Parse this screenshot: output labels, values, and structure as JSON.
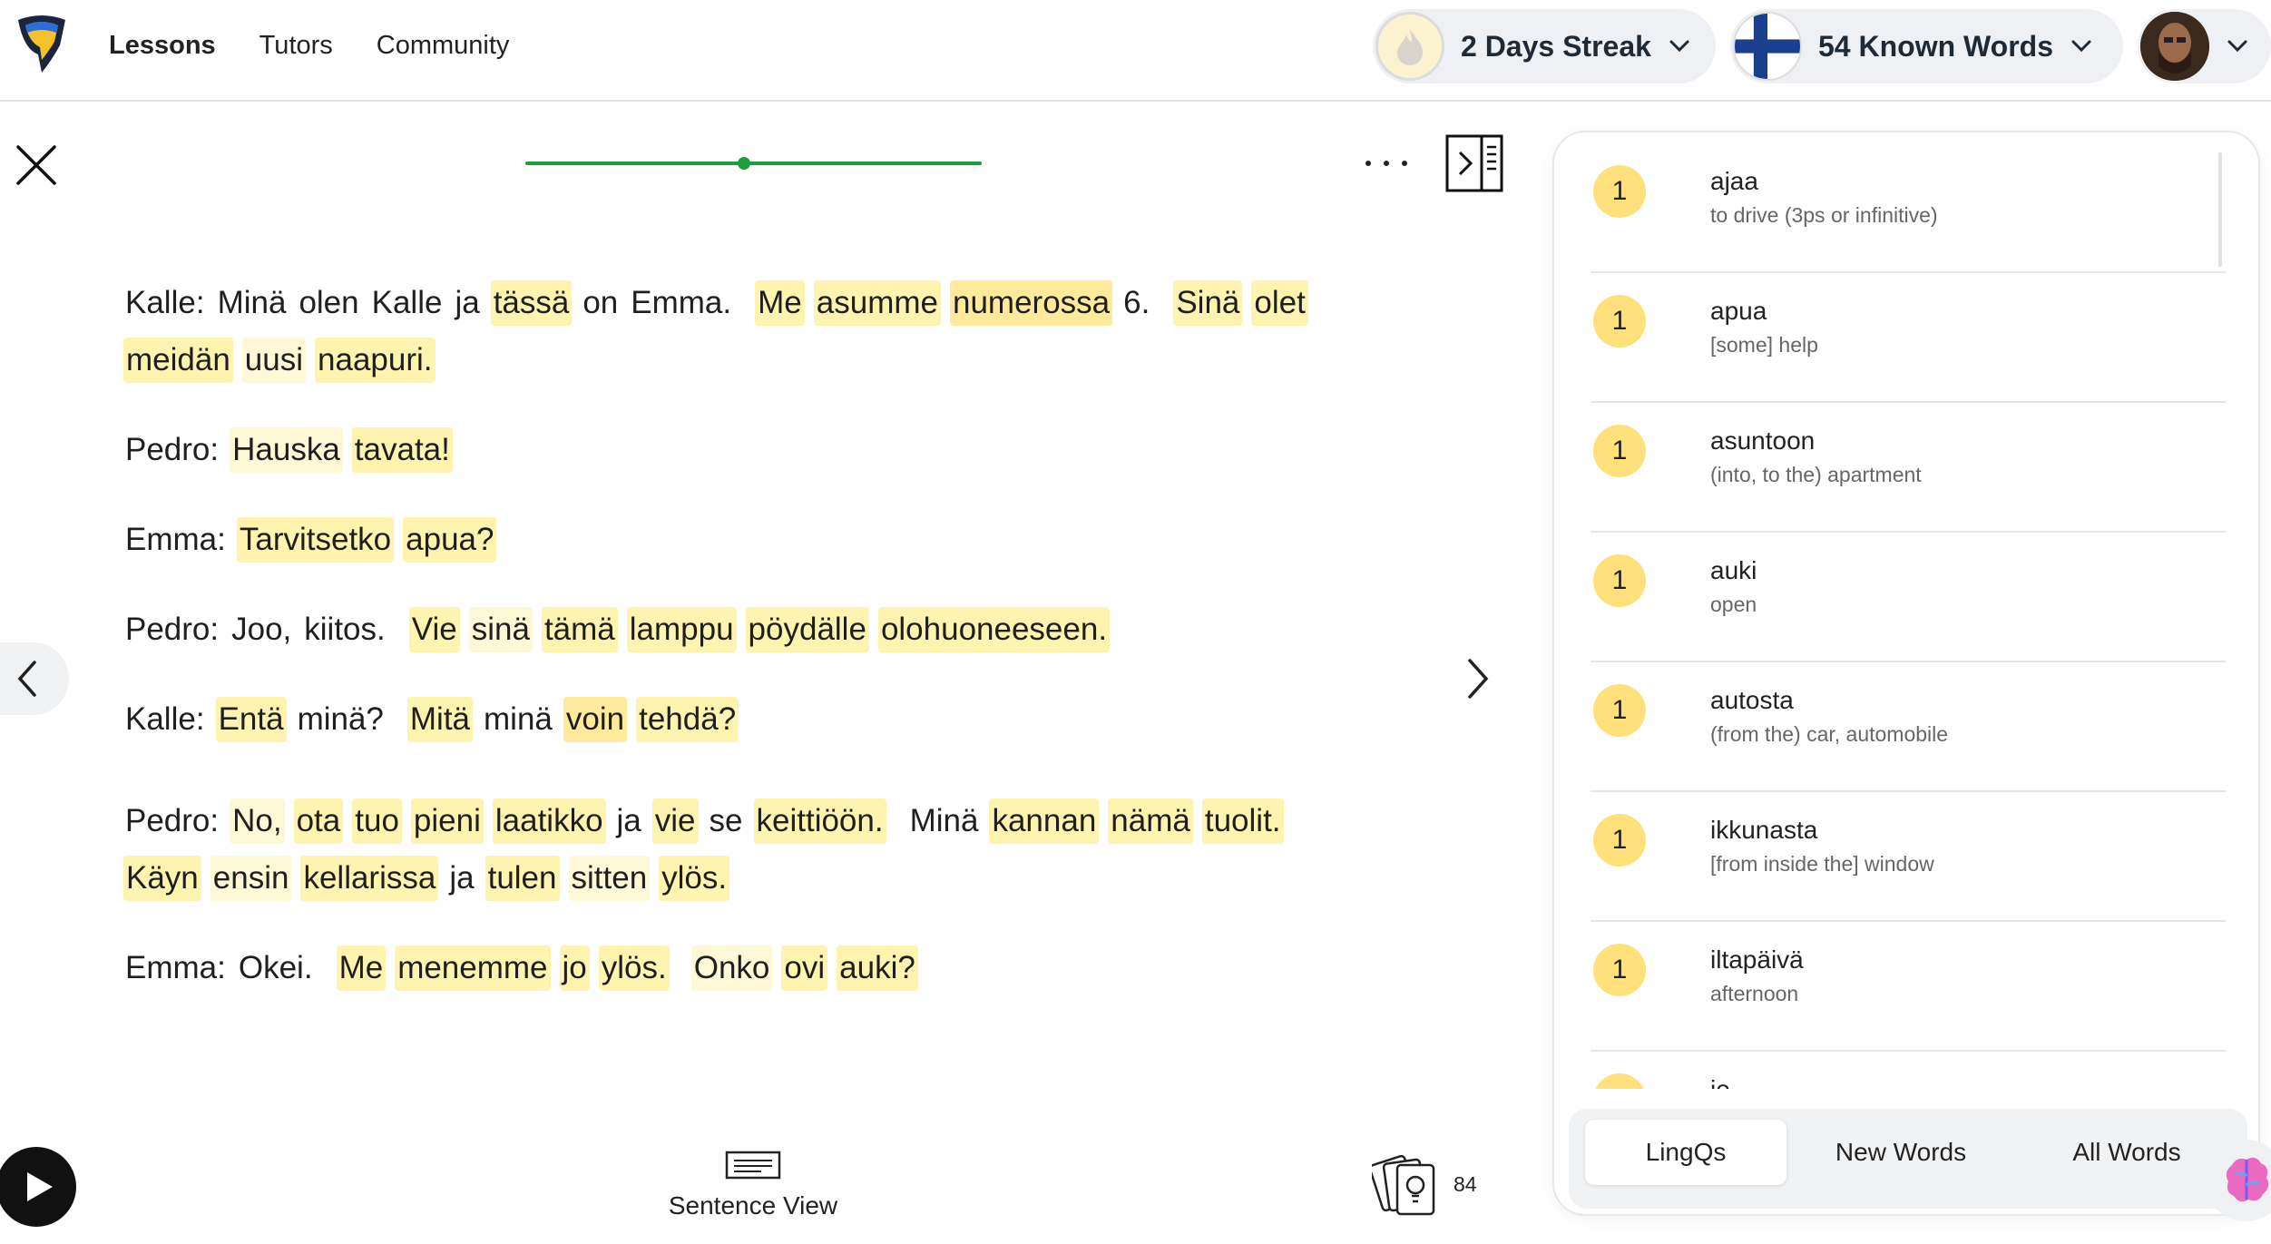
{
  "nav": {
    "items": [
      {
        "label": "Lessons",
        "active": true
      },
      {
        "label": "Tutors",
        "active": false
      },
      {
        "label": "Community",
        "active": false
      }
    ]
  },
  "header": {
    "streak_label": "2 Days Streak",
    "known_words_label": "54 Known Words"
  },
  "reader": {
    "progress_fraction": 0.48,
    "paragraphs": [
      {
        "lines": [
          [
            [
              "Kalle:",
              "known"
            ],
            [
              "Minä",
              "known"
            ],
            [
              "olen",
              "known"
            ],
            [
              "Kalle",
              "known"
            ],
            [
              "ja",
              "known"
            ],
            [
              "tässä",
              "l1"
            ],
            [
              "on",
              "known"
            ],
            [
              "Emma.",
              "known",
              true
            ],
            [
              "Me",
              "l1"
            ],
            [
              "asumme",
              "l1"
            ],
            [
              "numerossa",
              "l2"
            ],
            [
              "6.",
              "known",
              true
            ],
            [
              "Sinä",
              "l1"
            ],
            [
              "olet",
              "l1"
            ]
          ],
          [
            [
              "meidän",
              "l1"
            ],
            [
              "uusi",
              "new"
            ],
            [
              "naapuri.",
              "l1"
            ]
          ]
        ]
      },
      {
        "lines": [
          [
            [
              "Pedro:",
              "known"
            ],
            [
              "Hauska",
              "new"
            ],
            [
              "tavata!",
              "l1"
            ]
          ]
        ]
      },
      {
        "lines": [
          [
            [
              "Emma:",
              "known"
            ],
            [
              "Tarvitsetko",
              "l1"
            ],
            [
              "apua?",
              "l1"
            ]
          ]
        ]
      },
      {
        "lines": [
          [
            [
              "Pedro:",
              "known"
            ],
            [
              "Joo,",
              "known"
            ],
            [
              "kiitos.",
              "known",
              true
            ],
            [
              "Vie",
              "l1"
            ],
            [
              "sinä",
              "new"
            ],
            [
              "tämä",
              "l1"
            ],
            [
              "lamppu",
              "l1"
            ],
            [
              "pöydälle",
              "l1"
            ],
            [
              "olohuoneeseen.",
              "l1"
            ]
          ]
        ]
      },
      {
        "lines": [
          [
            [
              "Kalle:",
              "known"
            ],
            [
              "Entä",
              "l1"
            ],
            [
              "minä?",
              "known",
              true
            ],
            [
              "Mitä",
              "l1"
            ],
            [
              "minä",
              "known"
            ],
            [
              "voin",
              "l2"
            ],
            [
              "tehdä?",
              "l1"
            ]
          ]
        ]
      },
      {
        "lines": [
          [
            [
              "Pedro:",
              "known"
            ],
            [
              "No,",
              "new"
            ],
            [
              "ota",
              "l1"
            ],
            [
              "tuo",
              "l1"
            ],
            [
              "pieni",
              "l1"
            ],
            [
              "laatikko",
              "l1"
            ],
            [
              "ja",
              "known"
            ],
            [
              "vie",
              "l1"
            ],
            [
              "se",
              "known"
            ],
            [
              "keittiöön.",
              "l1",
              true
            ],
            [
              "Minä",
              "known"
            ],
            [
              "kannan",
              "l1"
            ],
            [
              "nämä",
              "l1"
            ],
            [
              "tuolit.",
              "l1"
            ]
          ],
          [
            [
              "Käyn",
              "l1"
            ],
            [
              "ensin",
              "new"
            ],
            [
              "kellarissa",
              "l1"
            ],
            [
              "ja",
              "known"
            ],
            [
              "tulen",
              "l1"
            ],
            [
              "sitten",
              "new"
            ],
            [
              "ylös.",
              "l1"
            ]
          ]
        ]
      },
      {
        "lines": [
          [
            [
              "Emma:",
              "known"
            ],
            [
              "Okei.",
              "known",
              true
            ],
            [
              "Me",
              "l1"
            ],
            [
              "menemme",
              "l1"
            ],
            [
              "jo",
              "l1"
            ],
            [
              "ylös.",
              "l1",
              true
            ],
            [
              "Onko",
              "new"
            ],
            [
              "ovi",
              "l1"
            ],
            [
              "auki?",
              "l1"
            ]
          ]
        ]
      }
    ]
  },
  "bottom": {
    "sentence_view_label": "Sentence View",
    "cards_count": "84"
  },
  "lingqs": [
    {
      "status": "1",
      "term": "ajaa",
      "translation": "to drive (3ps or infinitive)"
    },
    {
      "status": "1",
      "term": "apua",
      "translation": "[some] help"
    },
    {
      "status": "1",
      "term": "asuntoon",
      "translation": "(into, to the) apartment"
    },
    {
      "status": "1",
      "term": "auki",
      "translation": "open"
    },
    {
      "status": "1",
      "term": "autosta",
      "translation": "(from the) car, automobile"
    },
    {
      "status": "1",
      "term": "ikkunasta",
      "translation": "[from inside the] window"
    },
    {
      "status": "1",
      "term": "iltapäivä",
      "translation": "afternoon"
    },
    {
      "status": "1",
      "term": "jo",
      "translation": ""
    }
  ],
  "side_tabs": [
    {
      "label": "LingQs",
      "active": true
    },
    {
      "label": "New Words",
      "active": false
    },
    {
      "label": "All Words",
      "active": false
    }
  ],
  "colors": {
    "progress": "#1e9f3a",
    "highlight_lingq": "#fff3b0",
    "highlight_new": "#fff8d6",
    "badge": "#ffe07a"
  }
}
